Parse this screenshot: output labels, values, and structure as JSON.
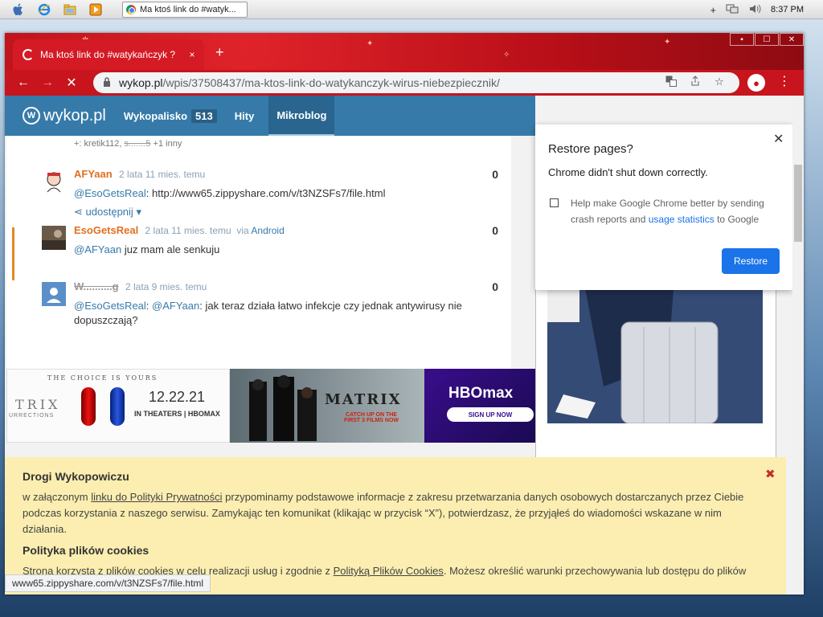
{
  "taskbar": {
    "task_title": "Ma ktoś link do #watyk...",
    "clock": "8:37 PM",
    "tray": {
      "plus": "+"
    }
  },
  "browser": {
    "tab_title": "Ma ktoś link do #watykańczyk ?",
    "tab_close": "×",
    "new_tab": "+",
    "url_host": "wykop.pl",
    "url_path": "/wpis/37508437/ma-ktos-link-do-watykanczyk-wirus-niebezpiecznik/",
    "win_buttons": [
      "▪",
      "☐",
      "✕"
    ]
  },
  "site": {
    "logo_text": "wykop.pl",
    "nav": [
      {
        "label": "Wykopalisko",
        "count": "513"
      },
      {
        "label": "Hity"
      },
      {
        "label": "Mikroblog"
      }
    ]
  },
  "comments": {
    "voters_prefix": "+: kretik112, ",
    "voters_struck": "s.......5",
    "voters_suffix": " +1 inny",
    "items": [
      {
        "author": "AFYaan",
        "meta": "2 lata 11 mies. temu",
        "score": "0",
        "mention": "@EsoGetsReal",
        "text": ": http://www65.zippyshare.com/v/t3NZSFs7/file.html",
        "share": "udostępnij"
      },
      {
        "author": "EsoGetsReal",
        "meta": "2 lata 11 mies. temu",
        "via": "via",
        "source": "Android",
        "score": "0",
        "mention": "@AFYaan",
        "text": " juz mam ale senkuju"
      },
      {
        "author": "W..........g",
        "meta": "2 lata 9 mies. temu",
        "score": "0",
        "mention": "@EsoGetsReal",
        "text_sep": ": ",
        "mention2": "@AFYaan",
        "text": ": jak teraz działa łatwo infekcje czy jednak antywirusy nie dopuszczają?"
      }
    ]
  },
  "ads": {
    "ad1_tagline": "THE CHOICE IS YOURS",
    "ad1_matrix": "TRIX",
    "ad1_sub": "URRECTIONS",
    "ad1_date": "12.22.21",
    "ad1_theaters": "IN THEATERS | HBOMAX",
    "ad2_title": "MATRIX",
    "ad2_catch": "CATCH UP ON THE FIRST 3 FILMS NOW",
    "ad3_logo": "HBOmax",
    "ad3_cta": "SIGN UP NOW"
  },
  "restore": {
    "title": "Restore pages?",
    "subtitle": "Chrome didn't shut down correctly.",
    "check_label": "Help make Google Chrome better by sending crash reports and ",
    "check_link": "usage statistics",
    "check_tail": " to Google",
    "button": "Restore",
    "close": "✕"
  },
  "cookie": {
    "heading1": "Drogi Wykopowiczu",
    "p1_a": "w załączonym ",
    "p1_link": "linku do Polityki Prywatności",
    "p1_b": " przypominamy podstawowe informacje z zakresu przetwarzania danych osobowych dostarczanych przez Ciebie podczas korzystania z naszego serwisu. Zamykając ten komunikat (klikając w przycisk “X”), potwierdzasz, że przyjąłeś do wiadomości wskazane w nim działania.",
    "heading2": "Polityka plików cookies",
    "p2_a": "Strona korzysta z plików cookies w celu realizacji usług i zgodnie z ",
    "p2_link": "Polityką Plików Cookies",
    "p2_b": ". Możesz określić warunki przechowywania lub dostępu do plików",
    "close": "✖"
  },
  "status": "www65.zippyshare.com/v/t3NZSFs7/file.html",
  "colors": {
    "wykop_blue": "#367aa9",
    "author_orange": "#e07020",
    "chrome_blue": "#1a73e8",
    "cookie_bg": "#fbeeb0"
  }
}
